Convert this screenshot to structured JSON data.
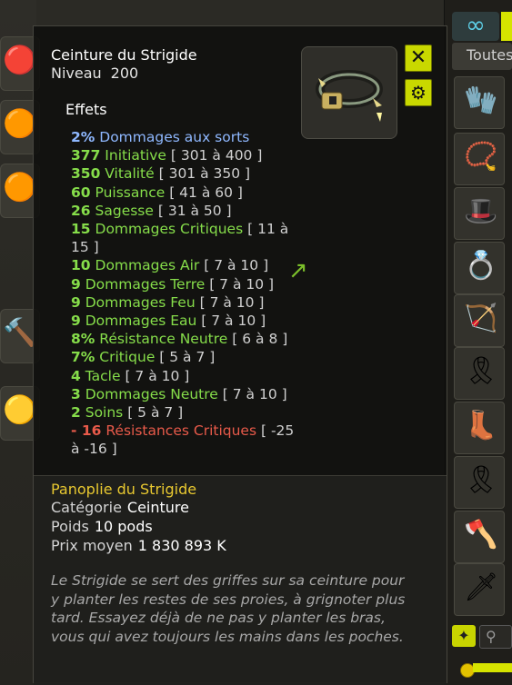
{
  "tooltip": {
    "item_name": "Ceinture du Strigide",
    "level_label": "Niveau",
    "level_value": "200",
    "effects_title": "Effets",
    "effects": [
      {
        "value": "2%",
        "text": "Dommages aux sorts",
        "range": "",
        "type": "blue"
      },
      {
        "value": "377",
        "text": "Initiative",
        "range": "[ 301 à 400 ]",
        "type": "green"
      },
      {
        "value": "350",
        "text": "Vitalité",
        "range": "[ 301 à 350 ]",
        "type": "green"
      },
      {
        "value": "60",
        "text": "Puissance",
        "range": "[ 41 à 60 ]",
        "type": "green"
      },
      {
        "value": "26",
        "text": "Sagesse",
        "range": "[ 31 à 50 ]",
        "type": "green"
      },
      {
        "value": "15",
        "text": "Dommages Critiques",
        "range": "[ 11 à 15 ]",
        "type": "green"
      },
      {
        "value": "10",
        "text": "Dommages Air",
        "range": "[ 7 à 10 ]",
        "type": "green"
      },
      {
        "value": "9",
        "text": "Dommages Terre",
        "range": "[ 7 à 10 ]",
        "type": "green"
      },
      {
        "value": "9",
        "text": "Dommages Feu",
        "range": "[ 7 à 10 ]",
        "type": "green"
      },
      {
        "value": "9",
        "text": "Dommages Eau",
        "range": "[ 7 à 10 ]",
        "type": "green"
      },
      {
        "value": "8%",
        "text": "Résistance Neutre",
        "range": "[ 6 à 8 ]",
        "type": "green"
      },
      {
        "value": "7%",
        "text": "Critique",
        "range": "[ 5 à 7 ]",
        "type": "green"
      },
      {
        "value": "4",
        "text": "Tacle",
        "range": "[ 7 à 10 ]",
        "type": "green"
      },
      {
        "value": "3",
        "text": "Dommages Neutre",
        "range": "[ 7 à 10 ]",
        "type": "green"
      },
      {
        "value": "2",
        "text": "Soins",
        "range": "[ 5 à 7 ]",
        "type": "green"
      },
      {
        "value": "- 16",
        "text": "Résistances Critiques",
        "range": "[ -25 à -16 ]",
        "type": "red"
      }
    ],
    "set_name": "Panoplie du Strigide",
    "category_label": "Catégorie",
    "category_value": "Ceinture",
    "weight_label": "Poids",
    "weight_value": "10 pods",
    "price_label": "Prix moyen",
    "price_value": "1 830 893 K",
    "description": "Le Strigide se sert des griffes sur sa ceinture pour y planter les restes de ses proies, à grignoter plus tard. Essayez déjà de ne pas y planter les bras, vous qui avez toujours les mains dans les poches."
  },
  "sidebar": {
    "filter_label": "Toutes"
  },
  "icons": {
    "close": "close-icon",
    "gear": "gear-icon",
    "infinite": "infinity-icon",
    "search": "search-icon"
  }
}
